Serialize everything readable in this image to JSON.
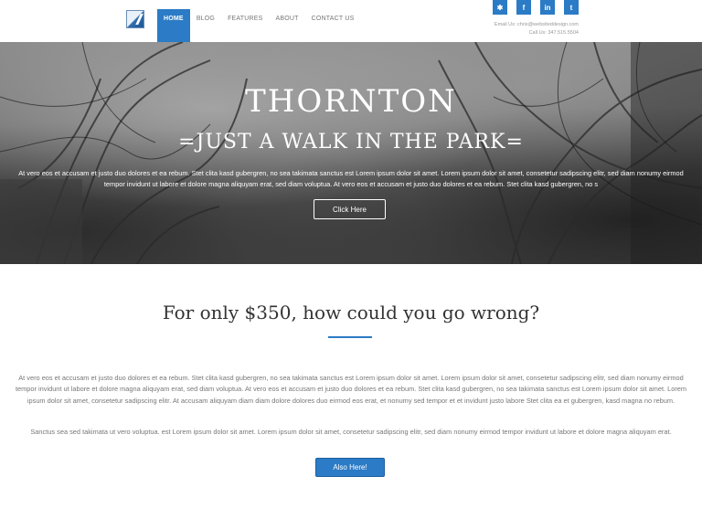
{
  "header": {
    "nav": [
      "HOME",
      "BLOG",
      "FEATURES",
      "ABOUT",
      "CONTACT US"
    ],
    "social": [
      {
        "icon": "yelp-icon",
        "glyph": "✱"
      },
      {
        "icon": "facebook-icon",
        "glyph": "f"
      },
      {
        "icon": "linkedin-icon",
        "glyph": "in"
      },
      {
        "icon": "twitter-icon",
        "glyph": "t"
      }
    ],
    "email": "Email Us: chris@websiteddesign.com",
    "phone": "Call Us: 347.515.5504"
  },
  "hero": {
    "title": "THORNTON",
    "subtitle": "=JUST A WALK IN THE PARK=",
    "text": "At vero eos et accusam et justo duo dolores et ea rebum. Stet clita kasd gubergren, no sea takimata sanctus est Lorem ipsum dolor sit amet. Lorem ipsum dolor sit amet, consetetur sadipscing elitr, sed diam nonumy eirmod tempor invidunt ut labore et dolore magna aliquyam erat, sed diam voluptua. At vero eos et accusam et justo duo dolores et ea rebum. Stet clita kasd gubergren, no s",
    "button": "Click Here"
  },
  "content": {
    "headline": "For only $350, how could you go wrong?",
    "para1": "At vero eos et accusam et justo duo dolores et ea rebum. Stet clita kasd gubergren, no sea takimata sanctus est Lorem ipsum dolor sit amet. Lorem ipsum dolor sit amet, consetetur sadipscing elitr, sed diam nonumy eirmod tempor invidunt ut labore et dolore magna aliquyam erat, sed diam voluptua. At vero eos et accusam et justo duo dolores et ea rebum. Stet clita kasd gubergren, no sea takimata sanctus est Lorem ipsum dolor sit amet. Lorem ipsum dolor sit amet, consetetur sadipscing elitr. At accusam aliquyam diam diam dolore dolores duo eirmod eos erat, et nonumy sed tempor et et invidunt justo labore Stet clita ea et gubergren, kasd magna no rebum.",
    "para2": "Sanctus sea sed takimata ut vero voluptua. est Lorem ipsum dolor sit amet. Lorem ipsum dolor sit amet, consetetur sadipscing elitr, sed diam nonumy eirmod tempor invidunt ut labore et dolore magna aliquyam erat.",
    "button": "Also Here!"
  },
  "colors": {
    "accent": "#2b7bc6",
    "text": "#777777",
    "heading": "#333333"
  }
}
